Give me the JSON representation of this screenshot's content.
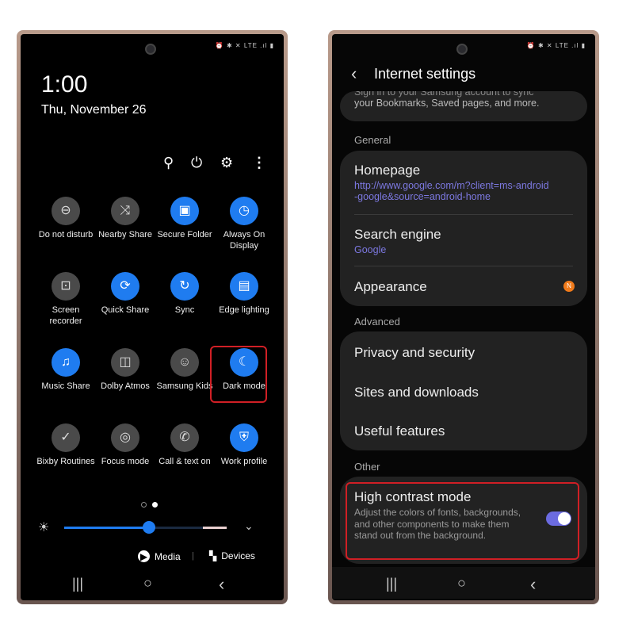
{
  "left": {
    "status_icons": "⏰ ✱ ✕ LTE .ıl ▮",
    "time": "1:00",
    "date": "Thu, November 26",
    "toolbar": [
      "search-icon",
      "power-icon",
      "gear-icon",
      "more-icon"
    ],
    "tiles": [
      {
        "label": "Do not disturb",
        "icon": "⊖",
        "on": false
      },
      {
        "label": "Nearby Share",
        "icon": "⤨",
        "on": false
      },
      {
        "label": "Secure Folder",
        "icon": "▣",
        "on": true
      },
      {
        "label": "Always On Display",
        "icon": "◷",
        "on": true
      },
      {
        "label": "Screen recorder",
        "icon": "⊡",
        "on": false
      },
      {
        "label": "Quick Share",
        "icon": "⟳",
        "on": true
      },
      {
        "label": "Sync",
        "icon": "↻",
        "on": true
      },
      {
        "label": "Edge lighting",
        "icon": "▤",
        "on": true
      },
      {
        "label": "Music Share",
        "icon": "♫",
        "on": true
      },
      {
        "label": "Dolby Atmos",
        "icon": "◫",
        "on": false
      },
      {
        "label": "Samsung Kids",
        "icon": "☺",
        "on": false
      },
      {
        "label": "Dark mode",
        "icon": "☾",
        "on": true
      },
      {
        "label": "Bixby Routines",
        "icon": "✓",
        "on": false
      },
      {
        "label": "Focus mode",
        "icon": "◎",
        "on": false
      },
      {
        "label": "Call & text on",
        "icon": "✆",
        "on": false
      },
      {
        "label": "Work profile",
        "icon": "⛨",
        "on": true
      }
    ],
    "brightness_percent": 52,
    "media_label": "Media",
    "devices_label": "Devices",
    "nav": [
      "|||",
      "○",
      "‹"
    ]
  },
  "right": {
    "status_icons": "⏰ ✱ ✕ LTE .ıl ▮",
    "title": "Internet settings",
    "account_text_partial": "Sign in to your Samsung account to sync",
    "account_text": "your Bookmarks, Saved pages, and more.",
    "general": "General",
    "homepage": "Homepage",
    "homepage_url_1": "http://www.google.com/m?client=ms-android",
    "homepage_url_2": "-google&source=android-home",
    "search_engine": "Search engine",
    "search_engine_value": "Google",
    "appearance": "Appearance",
    "appearance_badge": "N",
    "advanced": "Advanced",
    "privacy": "Privacy and security",
    "sites": "Sites and downloads",
    "useful": "Useful features",
    "other": "Other",
    "high_contrast": "High contrast mode",
    "high_contrast_desc": "Adjust the colors of fonts, backgrounds, and other components to make them stand out from the background.",
    "high_contrast_on": true,
    "nav": [
      "|||",
      "○",
      "‹"
    ]
  },
  "colors": {
    "accent": "#1f7cf0",
    "highlight": "#d01f25",
    "toggle": "#6b6be0",
    "badge": "#f07a1a",
    "link": "#7c78e0"
  }
}
